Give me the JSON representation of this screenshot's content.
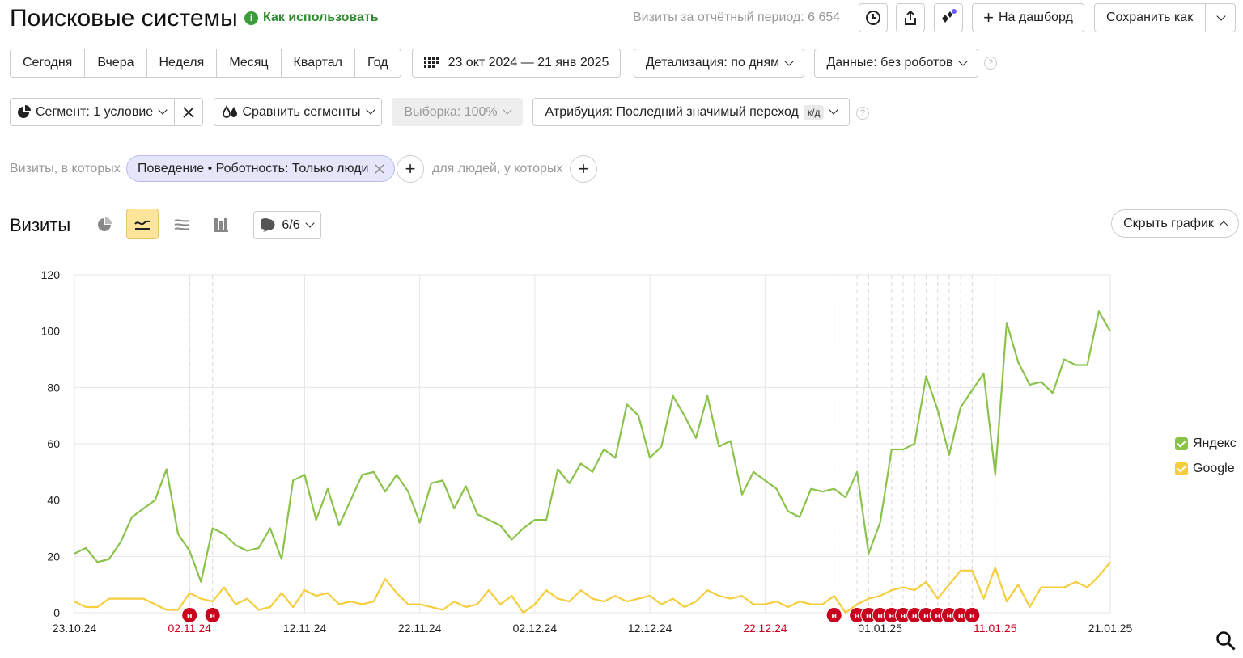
{
  "header": {
    "title": "Поисковые системы",
    "how_to": "Как использовать",
    "visits_total": "Визиты за отчётный период: 6 654",
    "to_dashboard": "На дашборд",
    "save_as": "Сохранить как"
  },
  "periods": [
    "Сегодня",
    "Вчера",
    "Неделя",
    "Месяц",
    "Квартал",
    "Год"
  ],
  "date_range": "23 окт 2024 — 21 янв 2025",
  "detail": "Детализация: по дням",
  "data_filter": "Данные: без роботов",
  "segment": {
    "label": "Сегмент: 1 условие",
    "compare": "Сравнить сегменты",
    "sample": "Выборка: 100%",
    "attribution": "Атрибуция: Последний значимый переход",
    "attribution_badge": "к/д"
  },
  "filter": {
    "prefix": "Визиты, в которых",
    "condition": "Поведение • Роботность: Только люди",
    "people_prefix": "для людей, у которых"
  },
  "chart_header": {
    "title": "Визиты",
    "annotations": "6/6",
    "hide_chart": "Скрыть график"
  },
  "colors": {
    "yandex": "#8bc34a",
    "google": "#f5cd3d",
    "holiday": "#c8001e",
    "weekend_label": "#c8001e"
  },
  "chart_data": {
    "type": "line",
    "ylim": [
      0,
      120
    ],
    "yticks": [
      0,
      20,
      40,
      60,
      80,
      100,
      120
    ],
    "x_start": "23.10.24",
    "x_end": "21.01.25",
    "xticks": [
      {
        "label": "23.10.24",
        "index": 0,
        "weekend": false
      },
      {
        "label": "02.11.24",
        "index": 10,
        "weekend": true
      },
      {
        "label": "12.11.24",
        "index": 20,
        "weekend": false
      },
      {
        "label": "22.11.24",
        "index": 30,
        "weekend": false
      },
      {
        "label": "02.12.24",
        "index": 40,
        "weekend": false
      },
      {
        "label": "12.12.24",
        "index": 50,
        "weekend": false
      },
      {
        "label": "22.12.24",
        "index": 60,
        "weekend": true
      },
      {
        "label": "01.01.25",
        "index": 70,
        "weekend": false
      },
      {
        "label": "11.01.25",
        "index": 80,
        "weekend": true
      },
      {
        "label": "21.01.25",
        "index": 90,
        "weekend": false
      }
    ],
    "holiday_marker": "н",
    "holidays": [
      10,
      12,
      66,
      68,
      69,
      70,
      71,
      72,
      73,
      74,
      75,
      76,
      77,
      78
    ],
    "series": [
      {
        "name": "Яндекс",
        "values": [
          21,
          23,
          18,
          19,
          25,
          34,
          37,
          40,
          51,
          28,
          22,
          11,
          30,
          28,
          24,
          22,
          23,
          30,
          19,
          47,
          49,
          33,
          44,
          31,
          40,
          49,
          50,
          43,
          49,
          43,
          32,
          46,
          47,
          37,
          45,
          35,
          33,
          31,
          26,
          30,
          33,
          33,
          51,
          46,
          53,
          50,
          58,
          55,
          74,
          70,
          55,
          59,
          77,
          70,
          62,
          77,
          59,
          61,
          42,
          50,
          47,
          44,
          36,
          34,
          44,
          43,
          44,
          41,
          50,
          21,
          32,
          58,
          58,
          60,
          84,
          72,
          56,
          73,
          79,
          85,
          49,
          103,
          89,
          81,
          82,
          78,
          90,
          88,
          88,
          107,
          100
        ]
      },
      {
        "name": "Google",
        "values": [
          4,
          2,
          2,
          5,
          5,
          5,
          5,
          3,
          1,
          1,
          7,
          5,
          4,
          9,
          3,
          5,
          1,
          2,
          7,
          2,
          8,
          6,
          7,
          3,
          4,
          3,
          4,
          12,
          7,
          3,
          3,
          2,
          1,
          4,
          2,
          3,
          8,
          3,
          6,
          0,
          3,
          8,
          5,
          4,
          8,
          5,
          4,
          6,
          4,
          5,
          6,
          3,
          5,
          2,
          4,
          8,
          6,
          5,
          6,
          3,
          3,
          4,
          2,
          4,
          3,
          3,
          6,
          0,
          3,
          5,
          6,
          8,
          9,
          8,
          11,
          5,
          10,
          15,
          15,
          5,
          16,
          4,
          10,
          2,
          9,
          9,
          9,
          11,
          9,
          13,
          18
        ]
      }
    ]
  }
}
